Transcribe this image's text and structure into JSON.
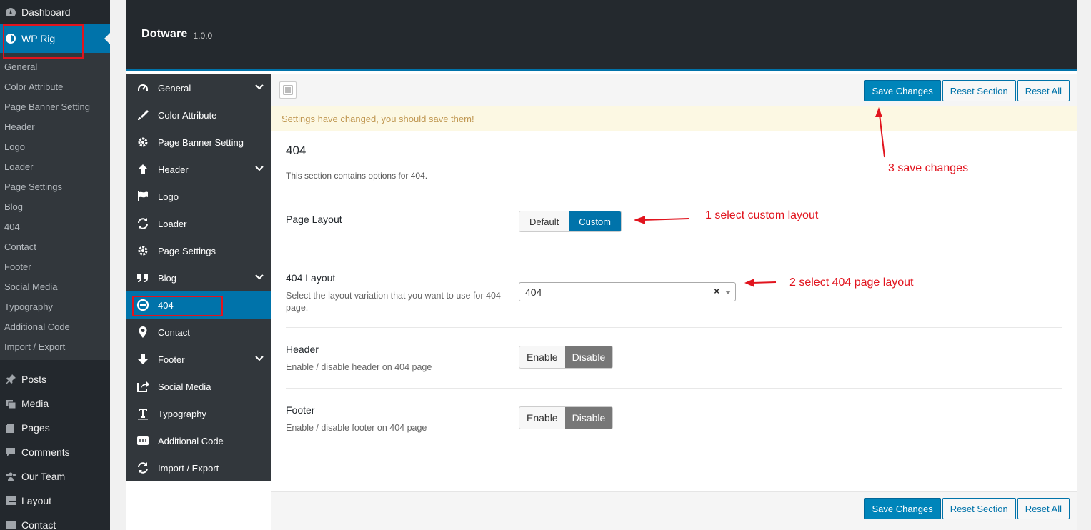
{
  "wp_menu": {
    "dashboard": "Dashboard",
    "wp_rig": "WP Rig",
    "sub_items": [
      "General",
      "Color Attribute",
      "Page Banner Setting",
      "Header",
      "Logo",
      "Loader",
      "Page Settings",
      "Blog",
      "404",
      "Contact",
      "Footer",
      "Social Media",
      "Typography",
      "Additional Code",
      "Import / Export"
    ],
    "lower_items": [
      "Posts",
      "Media",
      "Pages",
      "Comments",
      "Our Team",
      "Layout",
      "Contact"
    ]
  },
  "panel": {
    "title": "Dotware",
    "version": "1.0.0"
  },
  "nav": {
    "items": [
      "General",
      "Color Attribute",
      "Page Banner Setting",
      "Header",
      "Logo",
      "Loader",
      "Page Settings",
      "Blog",
      "404",
      "Contact",
      "Footer",
      "Social Media",
      "Typography",
      "Additional Code",
      "Import / Export"
    ],
    "active": "404"
  },
  "toolbar": {
    "save": "Save Changes",
    "reset_section": "Reset Section",
    "reset_all": "Reset All"
  },
  "notice": "Settings have changed, you should save them!",
  "section": {
    "title": "404",
    "description": "This section contains options for 404."
  },
  "fields": {
    "page_layout": {
      "label": "Page Layout",
      "options": [
        "Default",
        "Custom"
      ],
      "selected": "Custom"
    },
    "layout_404": {
      "label": "404 Layout",
      "description": "Select the layout variation that you want to use for 404 page.",
      "value": "404",
      "clear": "×"
    },
    "header": {
      "label": "Header",
      "description": "Enable / disable header on 404 page",
      "options": [
        "Enable",
        "Disable"
      ],
      "selected": "Disable"
    },
    "footer": {
      "label": "Footer",
      "description": "Enable / disable footer on 404 page",
      "options": [
        "Enable",
        "Disable"
      ],
      "selected": "Disable"
    }
  },
  "annotations": {
    "step1": "1 select custom layout",
    "step2": "2 select 404 page layout",
    "step3": "3 save changes",
    "color": "#e1141e"
  },
  "colors": {
    "accent": "#0073aa",
    "sidebar": "#23282d",
    "nav": "#32373c"
  }
}
